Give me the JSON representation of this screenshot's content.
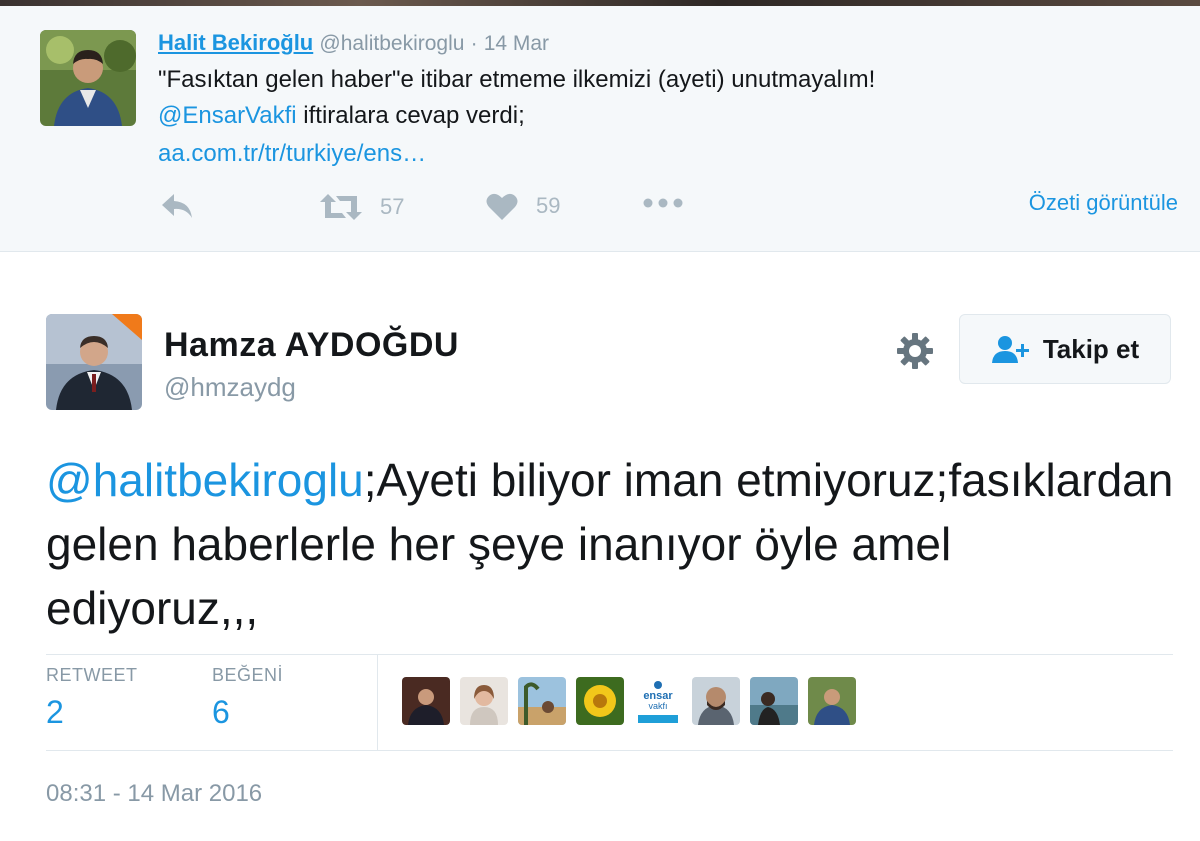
{
  "parent_tweet": {
    "author_name": "Halit Bekiroğlu",
    "handle": "@halitbekiroglu",
    "separator": "·",
    "date": "14 Mar",
    "line1": "\"Fasıktan gelen haber\"e itibar etmeme ilkemizi (ayeti) unutmayalım!",
    "mention": "@EnsarVakfi",
    "line2_rest": " iftiralara cevap verdi;",
    "link": "aa.com.tr/tr/turkiye/ens…",
    "retweet_count": "57",
    "like_count": "59",
    "summary_link": "Özeti görüntüle"
  },
  "main_tweet": {
    "author_name": "Hamza AYDOĞDU",
    "handle": "@hmzaydg",
    "follow_label": "Takip et",
    "mention": "@halitbekiroglu",
    "text": ";Ayeti biliyor iman etmiyoruz;fasıklardan gelen haberlerle her şeye inanıyor öyle amel ediyoruz,,,",
    "retweet_label": "RETWEET",
    "retweet_count": "2",
    "like_label": "BEĞENİ",
    "like_count": "6",
    "timestamp": "08:31 - 14 Mar 2016"
  },
  "colors": {
    "link": "#1b95e0",
    "muted": "#8899a6",
    "icon": "#aab8c2",
    "parent_bg": "#f5f8fa"
  },
  "liker_icons": [
    "liker-avatar-1",
    "liker-avatar-2",
    "liker-avatar-3",
    "liker-avatar-4",
    "ensar-vakfi-logo",
    "liker-avatar-6",
    "liker-avatar-7",
    "liker-avatar-8"
  ]
}
